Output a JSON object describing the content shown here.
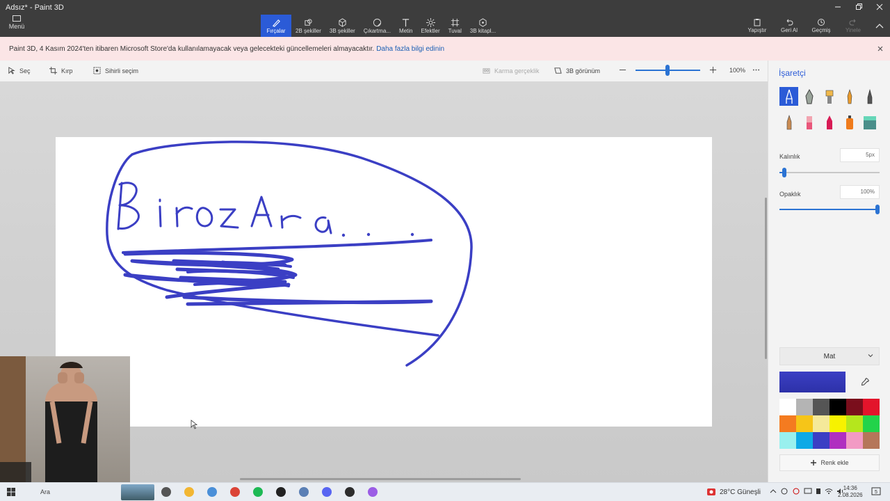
{
  "window": {
    "title": "Adsız* - Paint 3D"
  },
  "ribbon": {
    "menu_label": "Menü",
    "tools": [
      {
        "label": "Fırçalar",
        "icon": "brush-icon"
      },
      {
        "label": "2B şekiller",
        "icon": "shapes-2d-icon"
      },
      {
        "label": "3B şekiller",
        "icon": "cube-icon"
      },
      {
        "label": "Çıkartma...",
        "icon": "sticker-icon"
      },
      {
        "label": "Metin",
        "icon": "text-icon"
      },
      {
        "label": "Efektler",
        "icon": "effects-icon"
      },
      {
        "label": "Tuval",
        "icon": "canvas-icon"
      },
      {
        "label": "3B kitapl...",
        "icon": "library-icon"
      }
    ],
    "active_tool": "Fırçalar",
    "right": [
      {
        "label": "Yapıştır",
        "icon": "paste-icon"
      },
      {
        "label": "Geri Al",
        "icon": "undo-icon"
      },
      {
        "label": "Geçmiş",
        "icon": "history-icon"
      },
      {
        "label": "Yinele",
        "icon": "redo-icon"
      }
    ]
  },
  "notice": {
    "text": "Paint 3D, 4 Kasım 2024'ten itibaren Microsoft Store'da kullanılamayacak veya gelecekteki güncellemeleri almayacaktır.",
    "link": "Daha fazla bilgi edinin"
  },
  "subbar": {
    "select": "Seç",
    "crop": "Kırp",
    "magic_select": "Sihirli seçim",
    "mixed_reality": "Karma gerçeklik",
    "view_3d": "3B görünüm",
    "zoom": "100%"
  },
  "panel": {
    "title": "İşaretçi",
    "brushes": [
      "marker",
      "calligraphy-pen",
      "oil-brush",
      "watercolor",
      "pixel-pen",
      "pencil",
      "eraser",
      "crayon",
      "spray-can",
      "fill"
    ],
    "thickness_label": "Kalınlık",
    "thickness_value": "5px",
    "thickness_level": 0.05,
    "opacity_label": "Opaklık",
    "opacity_value": "100%",
    "opacity_level": 1.0,
    "finish": "Mat",
    "current_color": "#3b3fc4",
    "palette": [
      "#ffffff",
      "#b4b4b4",
      "#555555",
      "#000000",
      "#7a0e1c",
      "#e3142b",
      "#f47b20",
      "#f6c518",
      "#f5e99a",
      "#f7f200",
      "#b5e61d",
      "#22d34a",
      "#99f0ee",
      "#0ea9e6",
      "#3b3fc4",
      "#b02fc0",
      "#f29ac4",
      "#b5765a"
    ],
    "add_color": "Renk ekle"
  },
  "canvas": {
    "ink_color": "#3b3fc4"
  },
  "taskbar": {
    "search": "Ara",
    "weather": "28°C  Güneşli",
    "time": "14:36",
    "date": "2.08.2026",
    "apps": [
      {
        "name": "task-view",
        "color": "#555555"
      },
      {
        "name": "file-explorer",
        "color": "#f2b632"
      },
      {
        "name": "snipping",
        "color": "#4a8fd8"
      },
      {
        "name": "chrome",
        "color": "#db4437"
      },
      {
        "name": "spotify",
        "color": "#1db954"
      },
      {
        "name": "app-dark",
        "color": "#222222"
      },
      {
        "name": "settings",
        "color": "#5a7fb5"
      },
      {
        "name": "discord",
        "color": "#5865f2"
      },
      {
        "name": "obs",
        "color": "#2d2d2d"
      },
      {
        "name": "paint-3d",
        "color": "#9b5de5"
      }
    ]
  }
}
